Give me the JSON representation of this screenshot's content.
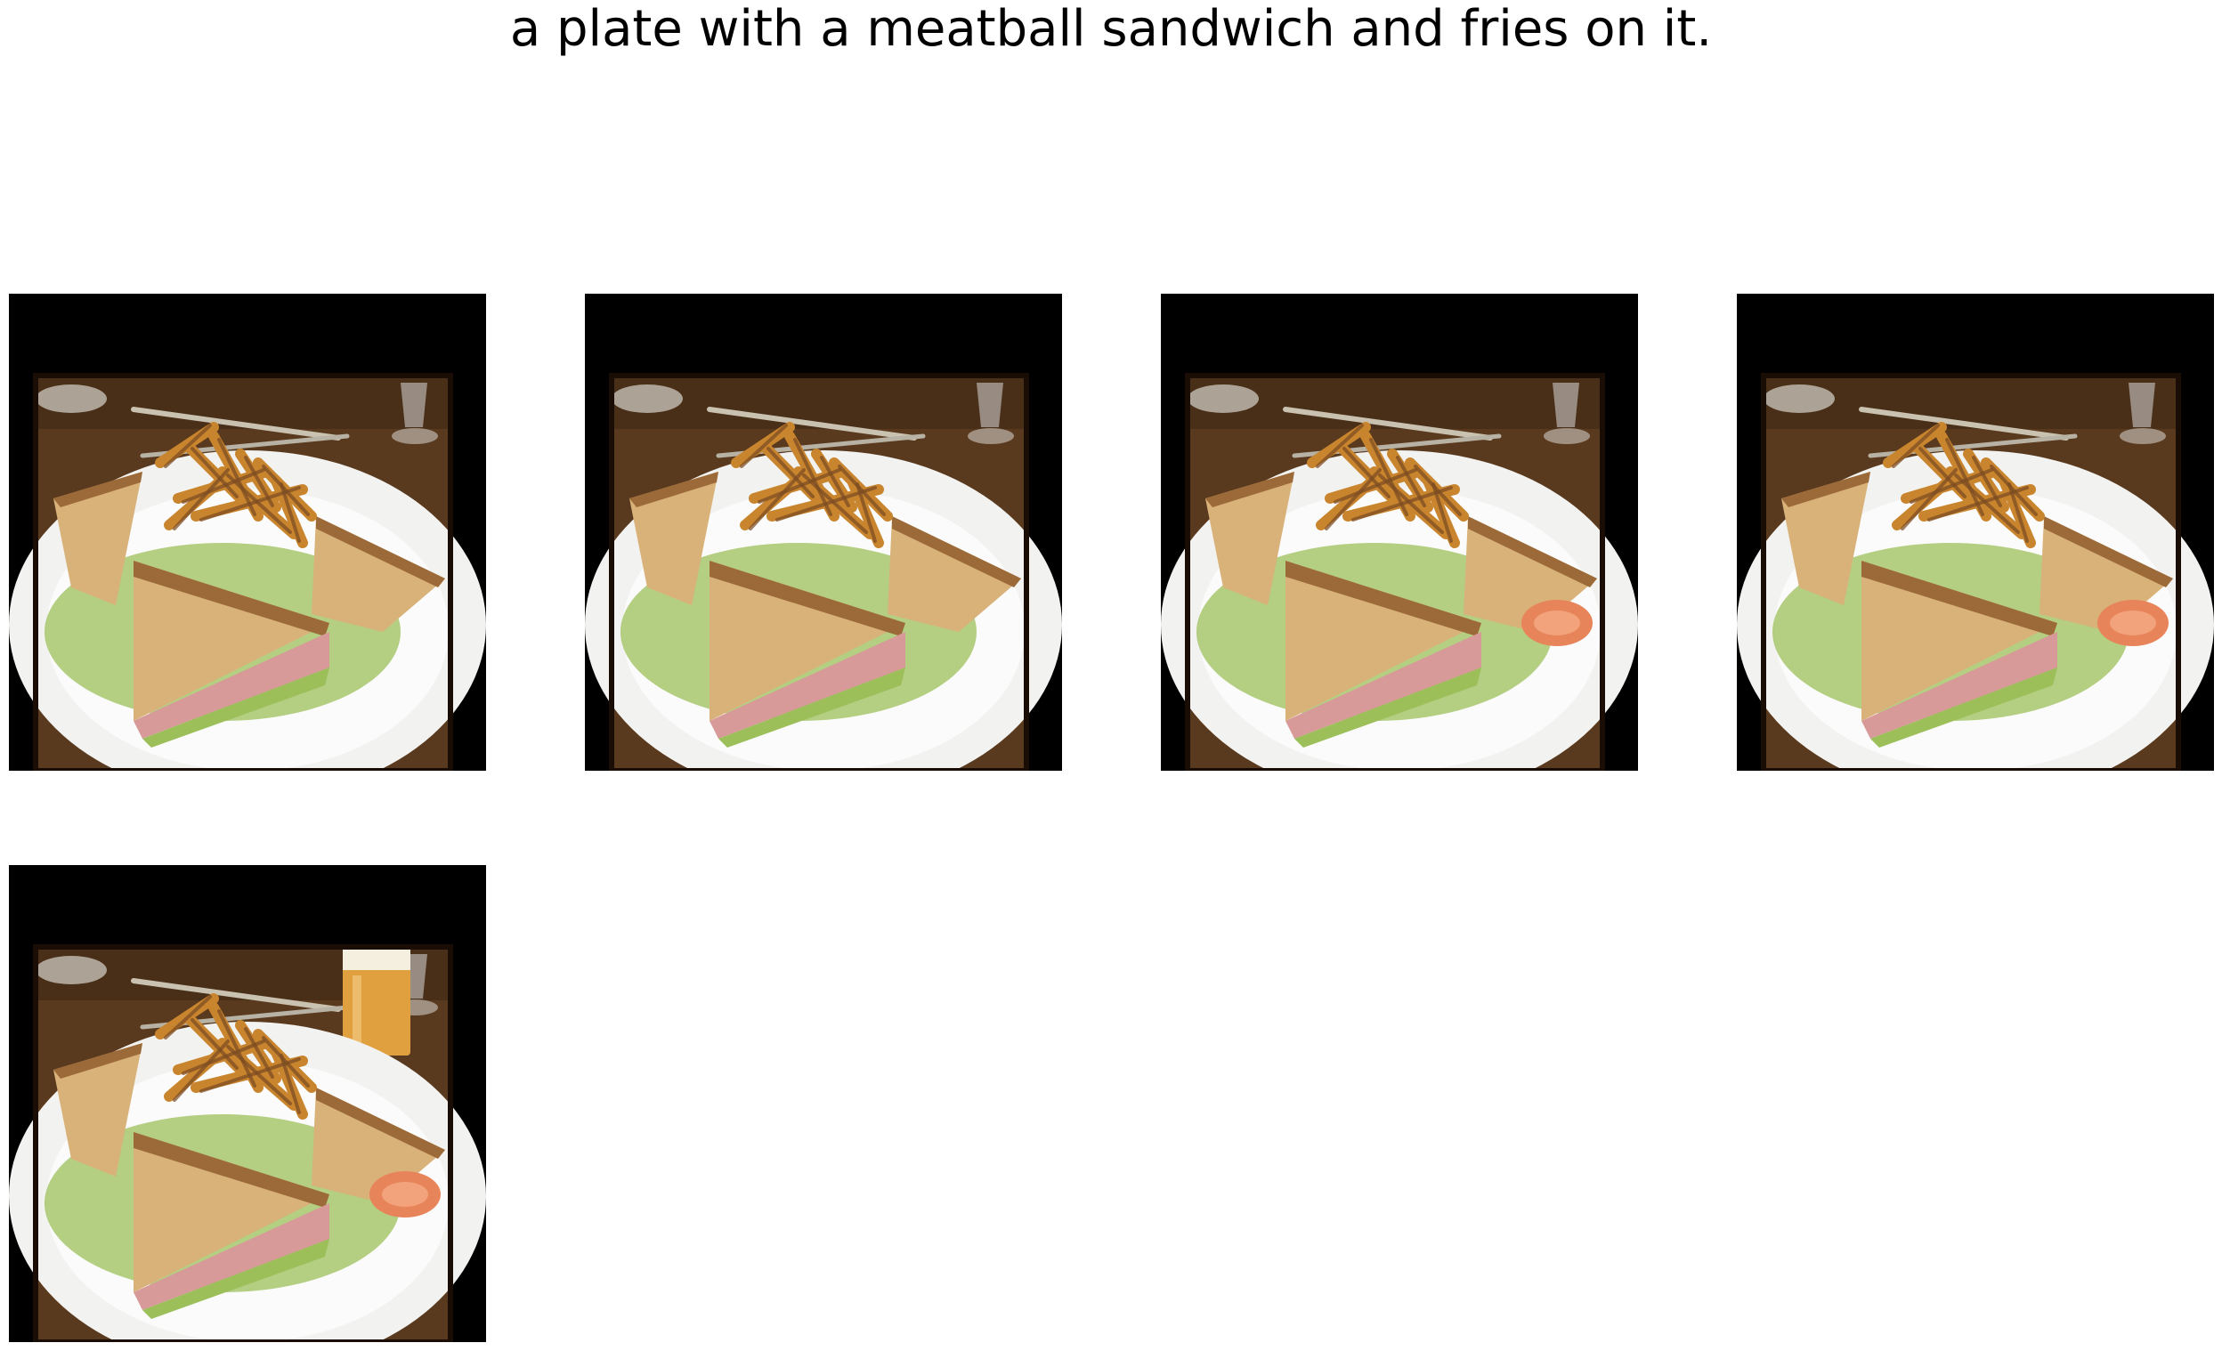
{
  "caption": "a plate with a meatball sandwich and fries on it.",
  "images": [
    {
      "name": "generated-image-1",
      "variant": "plain",
      "has_beer_glass": false
    },
    {
      "name": "generated-image-2",
      "variant": "plain",
      "has_beer_glass": false
    },
    {
      "name": "generated-image-3",
      "variant": "tomato",
      "has_beer_glass": false
    },
    {
      "name": "generated-image-4",
      "variant": "tomato",
      "has_beer_glass": false
    },
    {
      "name": "generated-image-5",
      "variant": "tomato",
      "has_beer_glass": true
    }
  ],
  "colors": {
    "background": "#ffffff",
    "frame": "#000000",
    "table_wood": "#5a3a1e",
    "plate": "#f2f2f0",
    "toast": "#d9b27a",
    "toast_crust": "#9c6a38",
    "fries": "#c9852e",
    "lettuce": "#9cbf5a",
    "ham": "#d79a98",
    "tomato": "#e8845a",
    "beer": "#e0a040"
  }
}
